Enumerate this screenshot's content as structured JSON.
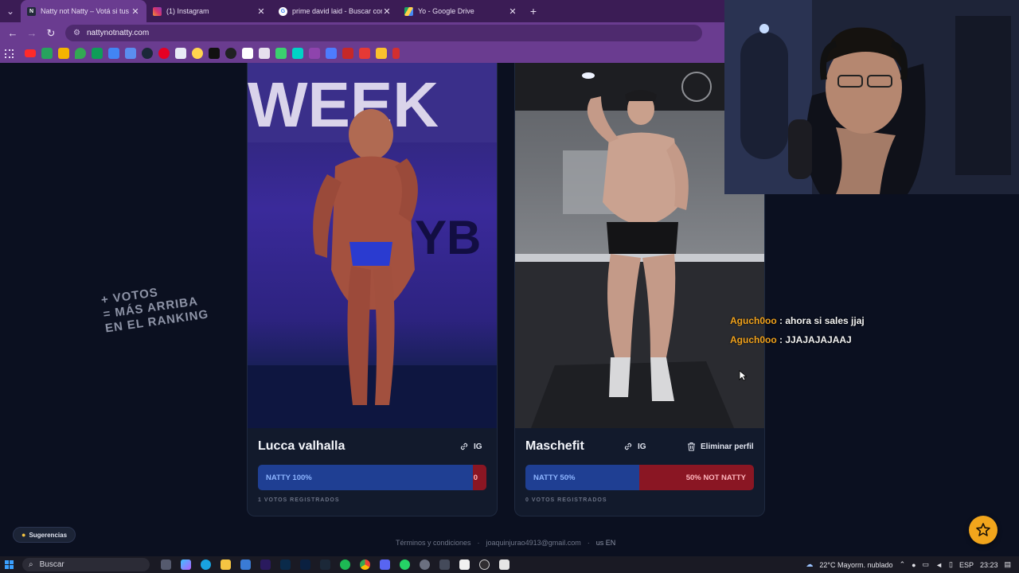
{
  "browser": {
    "tabs": [
      {
        "title": "Natty not Natty – Votá si tus at",
        "favicon": "N",
        "favicon_color": "#222a3a",
        "active": true
      },
      {
        "title": "(1) Instagram",
        "favicon": "ig",
        "favicon_color": "#d6336c",
        "active": false
      },
      {
        "title": "prime david laid - Buscar con G",
        "favicon": "G",
        "favicon_color": "#ffffff",
        "active": false
      },
      {
        "title": "Yo - Google Drive",
        "favicon": "drive",
        "favicon_color": "#1fa463",
        "active": false
      }
    ],
    "url": "nattynotnatty.com"
  },
  "promo": {
    "line1": "+ VOTOS",
    "line2": "= MÁS ARRIBA",
    "line3": "EN EL RANKING"
  },
  "profiles": [
    {
      "name": "Lucca valhalla",
      "ig_label": "IG",
      "natty_label": "NATTY 100%",
      "natty_pct": 97,
      "not_natty_label": "0",
      "votes": "1 VOTOS REGISTRADOS"
    },
    {
      "name": "Maschefit",
      "ig_label": "IG",
      "delete_label": "Eliminar perfil",
      "natty_label": "NATTY 50%",
      "natty_pct": 50,
      "not_natty_label": "50% NOT NATTY",
      "votes": "0 VOTOS REGISTRADOS"
    }
  ],
  "chat": [
    {
      "user": "Aguch0oo",
      "message": " : ahora si sales jjaj"
    },
    {
      "user": "Aguch0oo",
      "message": " : JJAJAJAJAAJ"
    }
  ],
  "suggestions_label": "Sugerencias",
  "footer": {
    "terms": "Términos y condiciones",
    "sep": "·",
    "email": "joaquinjurao4913@gmail.com",
    "lang_code": "us",
    "lang": "EN"
  },
  "taskbar": {
    "search_placeholder": "Buscar",
    "weather": "22°C  Mayorm. nublado",
    "lang": "ESP",
    "time": "23:23"
  },
  "colors": {
    "accent_purple": "#6a3c90",
    "natty_blue": "#1f3f93",
    "not_natty_red": "#8a1623",
    "chat_user": "#f1a21c",
    "fab_orange": "#f1a51c"
  }
}
